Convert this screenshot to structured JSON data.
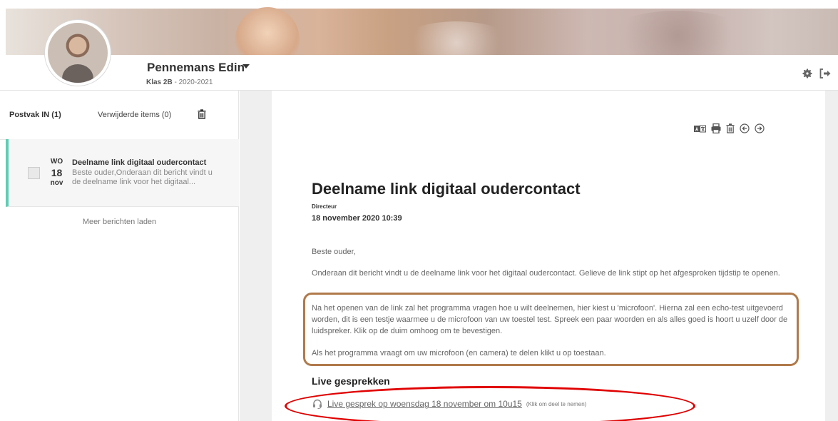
{
  "header": {
    "user_name": "Pennemans Edin",
    "class_label": "Klas 2B",
    "school_year": " - 2020-2021"
  },
  "mailbox": {
    "tab_inbox": "Postvak IN (1)",
    "tab_deleted": "Verwijderde items (0)",
    "messages": [
      {
        "day_of_week": "WO",
        "day": "18",
        "month": "nov",
        "title": "Deelname link digitaal oudercontact",
        "preview": "Beste ouder,Onderaan dit bericht vindt u de deelname link voor het digitaal..."
      }
    ],
    "load_more": "Meer berichten laden"
  },
  "message": {
    "title": "Deelname link digitaal oudercontact",
    "sender": "Directeur",
    "datetime": "18 november 2020 10:39",
    "paragraphs": [
      "Beste ouder,",
      "Onderaan dit bericht vindt u de deelname link voor het digitaal oudercontact. Gelieve de link stipt op het afgesproken tijdstip te openen.",
      "Na het openen van de link zal het programma vragen hoe u wilt deelnemen, hier kiest u 'microfoon'. Hierna zal een echo-test uitgevoerd worden, dit is een testje waarmee u de microfoon van uw toestel test. Spreek een paar woorden en als alles goed is hoort u uzelf door de luidspreker. Klik op de duim omhoog om te bevestigen.",
      "Als het programma vraagt om uw microfoon (en camera) te delen klikt u op toestaan."
    ],
    "live_section_title": "Live gesprekken",
    "live_link": "Live gesprek op woensdag 18 november om 10u15",
    "live_hint": "(Klik om deel te nemen)"
  },
  "colors": {
    "accent_teal": "#5ecdb4",
    "annotation_brown": "#b07a4a",
    "annotation_red": "#e00000"
  },
  "icons": [
    "gear-icon",
    "logout-icon",
    "trash-icon",
    "translate-icon",
    "print-icon",
    "previous-icon",
    "next-icon",
    "headset-icon"
  ]
}
